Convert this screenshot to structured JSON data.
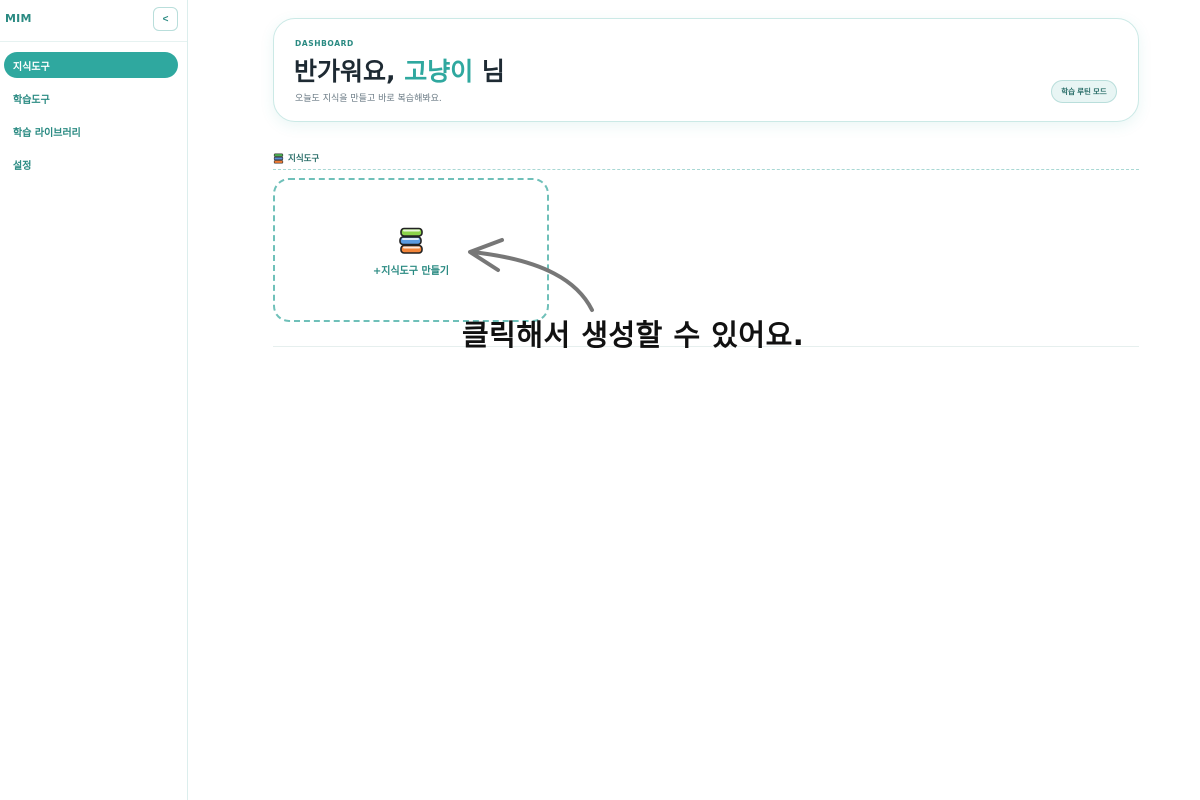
{
  "sidebar": {
    "brand": "MIM",
    "collapse_label": "<",
    "items": [
      {
        "label": "지식도구",
        "active": true
      },
      {
        "label": "학습도구",
        "active": false
      },
      {
        "label": "학습 라이브러리",
        "active": false
      },
      {
        "label": "설정",
        "active": false
      }
    ]
  },
  "hero": {
    "eyebrow": "DASHBOARD",
    "title_prefix": "반가워요, ",
    "title_name": "고냥이",
    "title_suffix": " 님",
    "subtitle": "오늘도 지식을 만들고 바로 복습해봐요.",
    "routine_button": "학습 루틴 모드"
  },
  "section": {
    "icon": "books-icon",
    "title": "지식도구"
  },
  "create_card": {
    "icon": "books-icon",
    "label": "+지식도구 만들기"
  },
  "annotation": {
    "text": "클릭해서 생성할 수 있어요."
  },
  "colors": {
    "accent": "#2fa89f",
    "accent_dark": "#2a8a82",
    "border": "#cbe9e6"
  }
}
